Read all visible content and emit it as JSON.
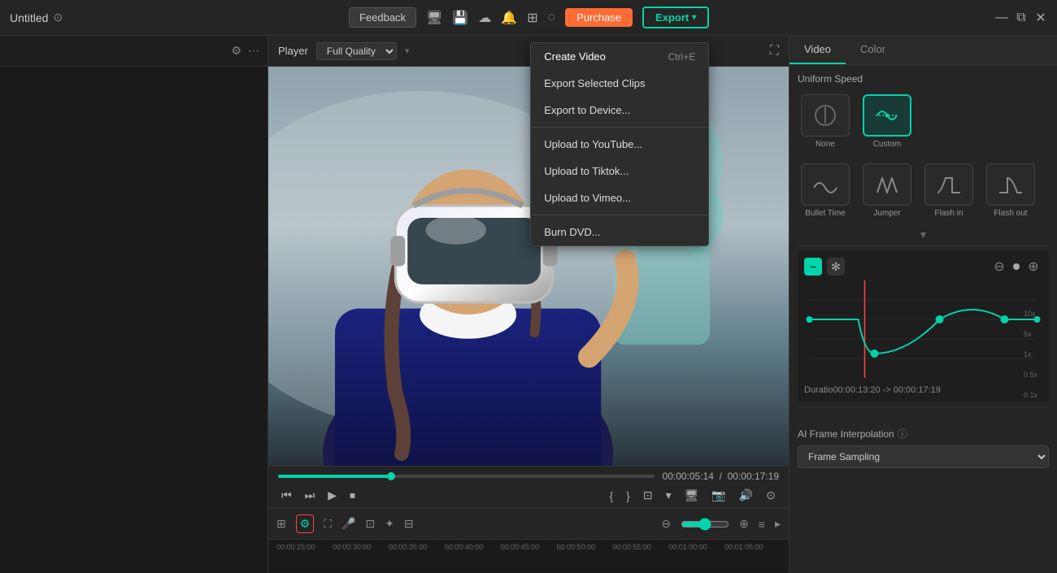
{
  "window": {
    "title": "Untitled"
  },
  "topbar": {
    "feedback_label": "Feedback",
    "purchase_label": "Purchase",
    "export_label": "Export",
    "export_arrow": "▾"
  },
  "export_dropdown": {
    "items": [
      {
        "label": "Create Video",
        "shortcut": "Ctrl+E"
      },
      {
        "label": "Export Selected Clips",
        "shortcut": ""
      },
      {
        "label": "Export to Device...",
        "shortcut": ""
      },
      {
        "label": "Upload to YouTube...",
        "shortcut": ""
      },
      {
        "label": "Upload to Tiktok...",
        "shortcut": ""
      },
      {
        "label": "Upload to Vimeo...",
        "shortcut": ""
      },
      {
        "label": "Burn DVD...",
        "shortcut": ""
      }
    ]
  },
  "player": {
    "label": "Player",
    "quality_label": "Full Quality",
    "current_time": "00:00:05:14",
    "total_time": "00:00:17:19"
  },
  "right_panel": {
    "tabs": [
      "Video",
      "Color"
    ],
    "speed_label": "Uniform Speed",
    "speed_options": [
      {
        "label": "None",
        "active": false
      },
      {
        "label": "Custom",
        "active": true
      },
      {
        "label": "Bullet Time",
        "active": false
      },
      {
        "label": "Jumper",
        "active": false
      },
      {
        "label": "Flash in",
        "active": false
      },
      {
        "label": "Flash out",
        "active": false
      }
    ],
    "duration_text": "Duratio00:00:13:20 -> 00:00:17:19",
    "ai_frame_label": "AI Frame Interpolation",
    "ai_frame_select": "Frame Sampling"
  },
  "timeline": {
    "ruler_marks": [
      "00:00:25:00",
      "00:00:30:00",
      "00:00:35:00",
      "00:00:40:00",
      "00:00:45:00",
      "00:00:50:00",
      "00:00:55:00",
      "00:01:00:00",
      "00:01:05:00"
    ]
  },
  "icons": {
    "filter": "⚙",
    "more": "⋯",
    "search": "🔍",
    "monitor": "🖥",
    "cloud": "☁",
    "grid": "⊞",
    "star": "✦",
    "chevron_down": "▾"
  },
  "colors": {
    "accent": "#00d4aa",
    "purchase_bg": "#ff6b35",
    "active_border": "#f44336"
  }
}
